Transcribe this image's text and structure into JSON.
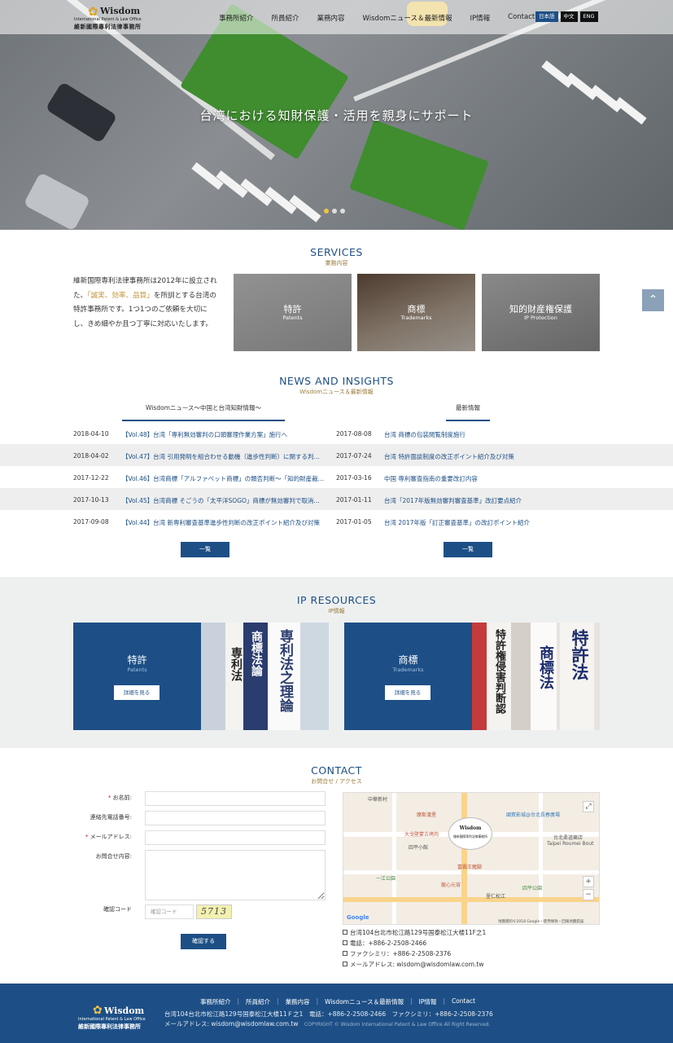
{
  "header": {
    "logo": {
      "en": "Wisdom",
      "sub": "International Patent & Law Office",
      "cn": "維新國際專利法律事務所"
    },
    "nav": [
      "事務所紹介",
      "所員紹介",
      "業務内容",
      "Wisdomニュース＆最新情報",
      "IP情報",
      "Contact"
    ],
    "langs": [
      {
        "label": "日本語",
        "active": true
      },
      {
        "label": "中文",
        "active": false
      },
      {
        "label": "ENG",
        "active": false
      }
    ],
    "hero_title": "台湾における知財保護・活用を親身にサポート",
    "slide_total": 3,
    "slide_active": 1
  },
  "services": {
    "title_en": "SERVICES",
    "title_jp": "業務内容",
    "intro_a": "維新国際専利法律事務所は2012年に設立された、",
    "intro_hl": "「誠実、効率、品質」",
    "intro_b": "を所訓とする台湾の特許事務所です。1つ1つのご依頼を大切にし、きめ細やか且つ丁寧に対応いたします。",
    "cards": [
      {
        "title": "特許",
        "sub": "Patents"
      },
      {
        "title": "商標",
        "sub": "Trademarks"
      },
      {
        "title": "知的財産権保護",
        "sub": "IP Protection"
      }
    ],
    "to_top": "⌃"
  },
  "news": {
    "title_en": "NEWS AND INSIGHTS",
    "title_jp": "Wisdomニュース＆最新情報",
    "tab_left": "Wisdomニュース～中国と台湾知財情報～",
    "tab_right": "最新情報",
    "left": [
      {
        "date": "2018-04-10",
        "text": "【Vol.48】台湾「専利無効審判の口頭審理作業方案」施行へ"
      },
      {
        "date": "2018-04-02",
        "text": "【Vol.47】台湾 引用発明を組合わせる動機（進歩性判断）に関する判例…"
      },
      {
        "date": "2017-12-22",
        "text": "【Vol.46】台湾商標「アルファベット商標」の類否判断～「知的財産裁…"
      },
      {
        "date": "2017-10-13",
        "text": "【Vol.45】台湾商標 そごうの「太平洋SOGO」商標が無効審判で取消さ…"
      },
      {
        "date": "2017-09-08",
        "text": "【Vol.44】台湾 新専利審査基準進歩性判断の改正ポイント紹介及び対策"
      }
    ],
    "right": [
      {
        "date": "2017-08-08",
        "text": "台湾 商標の包装閲覧制度施行"
      },
      {
        "date": "2017-07-24",
        "text": "台湾 特許面談制度の改正ポイント紹介及び対策"
      },
      {
        "date": "2017-03-16",
        "text": "中国 専利審査指南の重要改訂内容"
      },
      {
        "date": "2017-01-11",
        "text": "台湾「2017年版無効審判審査基準」改訂要点紹介"
      },
      {
        "date": "2017-01-05",
        "text": "台湾 2017年版「訂正審査基準」の改訂ポイント紹介"
      }
    ],
    "list_button": "一覧"
  },
  "ip": {
    "title_en": "IP RESOURCES",
    "title_jp": "IP情報",
    "cards": [
      {
        "title": "特許",
        "sub": "Patents",
        "button": "詳細を見る",
        "books": [
          "商標法論",
          "専利法",
          "専利法之理論"
        ]
      },
      {
        "title": "商標",
        "sub": "Trademarks",
        "button": "詳細を見る",
        "books": [
          "特許権侵害判断認",
          "商標法",
          "特許法"
        ]
      }
    ]
  },
  "contact": {
    "title_en": "CONTACT",
    "title_jp": "お問合せ / アクセス",
    "fields": [
      {
        "label": "お名前:",
        "required": true
      },
      {
        "label": "連絡先電話番号:",
        "required": false
      },
      {
        "label": "メールアドレス:",
        "required": true
      },
      {
        "label": "お問合せ内容:",
        "required": false
      }
    ],
    "captcha_label": "確認コード",
    "captcha_placeholder": "確認コード",
    "captcha_text": "5713",
    "submit": "確認する",
    "map": {
      "labels": [
        "中華新村",
        "摩斯漢堡",
        "國賓影城@台北長春廣場",
        "大戈壁蒙古烤肉",
        "台北柔道樂店",
        "Taipei Roumei Bout",
        "四平小館",
        "富霸王豬腳",
        "四平公園",
        "一江公園",
        "龍心元宵",
        "里仁松江",
        "Google",
        "地圖資料©2018 Google・使用條款・回報地圖錯誤"
      ],
      "pin_title": "Wisdom",
      "pin_sub": "維新國際專利法律事務所"
    },
    "address": [
      "台湾104台北市松江路129号国泰松江大楼11F之1",
      "電話：+886-2-2508-2466",
      "ファクシミリ：+886-2-2508-2376",
      "メールアドレス: wisdom@wisdomlaw.com.tw"
    ]
  },
  "footer": {
    "logo": {
      "en": "Wisdom",
      "sub": "International Patent & Law Office",
      "cn": "維新國際專利法律事務所"
    },
    "nav": [
      "事務所紹介",
      "所員紹介",
      "業務内容",
      "Wisdomニュース＆最新情報",
      "IP情報",
      "Contact"
    ],
    "address": "台湾104台北市松江路129号国泰松江大楼11Ｆ之1",
    "phone": "電話：+886-2-2508-2466　ファクシミリ：+886-2-2508-2376",
    "email": "メールアドレス: wisdom@wisdomlaw.com.tw",
    "copyright": "COPYRIGHT © Wisdom International Patent & Law Office All Right Reserved."
  },
  "colors": {
    "brand": "#1d4f86",
    "accent": "#c2913a",
    "hero_gray": "#7b8085"
  }
}
